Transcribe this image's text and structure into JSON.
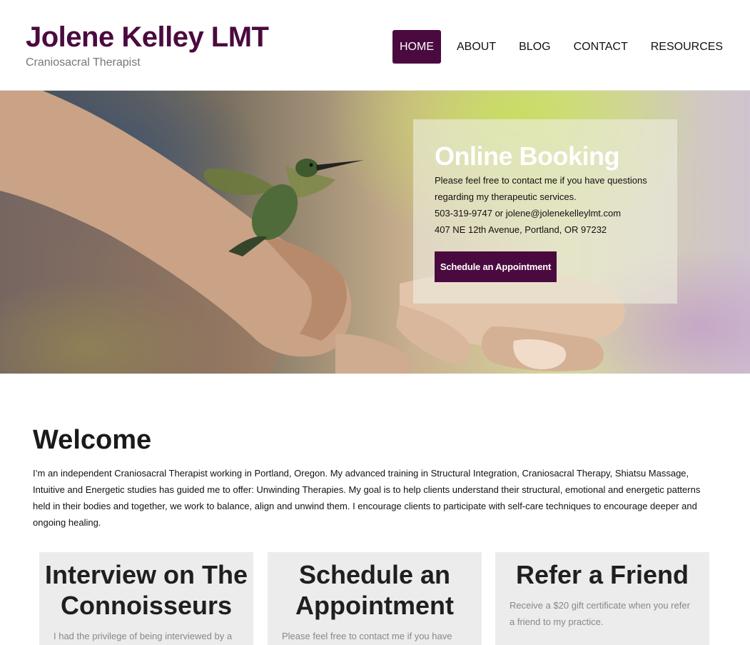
{
  "header": {
    "site_title": "Jolene Kelley LMT",
    "tagline": "Craniosacral Therapist"
  },
  "nav": {
    "items": [
      {
        "label": "HOME",
        "active": true
      },
      {
        "label": "ABOUT",
        "active": false
      },
      {
        "label": "BLOG",
        "active": false
      },
      {
        "label": "CONTACT",
        "active": false
      },
      {
        "label": "RESOURCES",
        "active": false
      }
    ]
  },
  "booking": {
    "title": "Online Booking",
    "line1": "Please feel free to contact me if you have questions",
    "line2": "regarding my therapeutic services.",
    "line3": "503-319-9747 or jolene@jolenekelleylmt.com",
    "line4": "407 NE 12th Avenue, Portland, OR 97232",
    "button_label": "Schedule an Appointment"
  },
  "welcome": {
    "title": "Welcome",
    "body": "I’m an independent Craniosacral Therapist working in Portland, Oregon.  My advanced training in Structural Integration, Craniosacral Therapy, Shiatsu Massage, Intuitive and Energetic studies has guided me to offer: Unwinding Therapies. My goal is to help clients understand their structural, emotional and energetic patterns held in their bodies and together, we work to balance, align and unwind them.  I encourage clients to participate with self-care techniques to encourage deeper and ongoing healing."
  },
  "cards": [
    {
      "title": "Interview on The Connoisseurs",
      "text": "I had the privilege of being interviewed by a"
    },
    {
      "title": "Schedule an Appointment",
      "text": "Please feel free to contact me if you have"
    },
    {
      "title": "Refer a Friend",
      "text": "Receive a $20 gift certificate when you refer a friend to my practice."
    }
  ],
  "colors": {
    "brand": "#4b0a3f",
    "card_bg": "#ececec"
  }
}
